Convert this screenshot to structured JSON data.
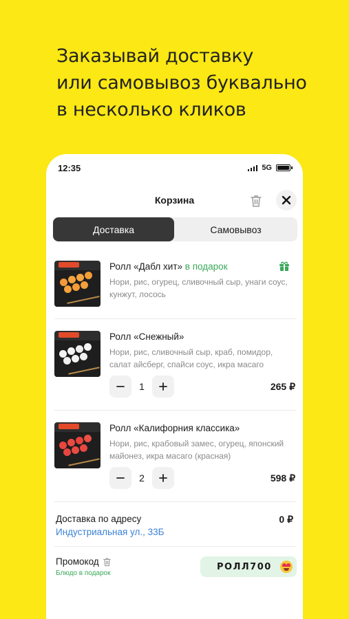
{
  "headline": {
    "line1": "Заказывай доставку",
    "line2": "или самовывоз буквально",
    "line3": "в несколько кликов"
  },
  "status_bar": {
    "time": "12:35",
    "network": "5G"
  },
  "cart": {
    "title": "Корзина",
    "tabs": [
      {
        "label": "Доставка",
        "active": true
      },
      {
        "label": "Самовывоз",
        "active": false
      }
    ],
    "items": [
      {
        "name": "Ролл «Дабл хит»",
        "gift_label": "в подарок",
        "description": "Нори, рис, огурец, сливочный сыр, унаги соус, кунжут, лосось",
        "icon": "gift-icon"
      },
      {
        "name": "Ролл «Снежный»",
        "description": "Нори, рис, сливочный сыр, краб, помидор, салат айсберг, спайси соус, икра масаго",
        "quantity": "1",
        "price": "265 ₽"
      },
      {
        "name": "Ролл «Калифорния классика»",
        "description": "Нори, рис, крабовый замес, огурец, японский майонез, икра масаго (красная)",
        "quantity": "2",
        "price": "598 ₽"
      }
    ],
    "delivery": {
      "label": "Доставка по адресу",
      "address": "Индустриальная ул., 33Б",
      "price": "0 ₽"
    },
    "promo": {
      "label": "Промокод",
      "sub": "Блюдо в подарок",
      "code": "РОЛЛ700"
    }
  },
  "colors": {
    "background": "#FBE814",
    "segment_active": "#373737",
    "gift_green": "#3aa85a",
    "link_blue": "#3b82d6",
    "promo_bg": "#e2f4e6"
  }
}
